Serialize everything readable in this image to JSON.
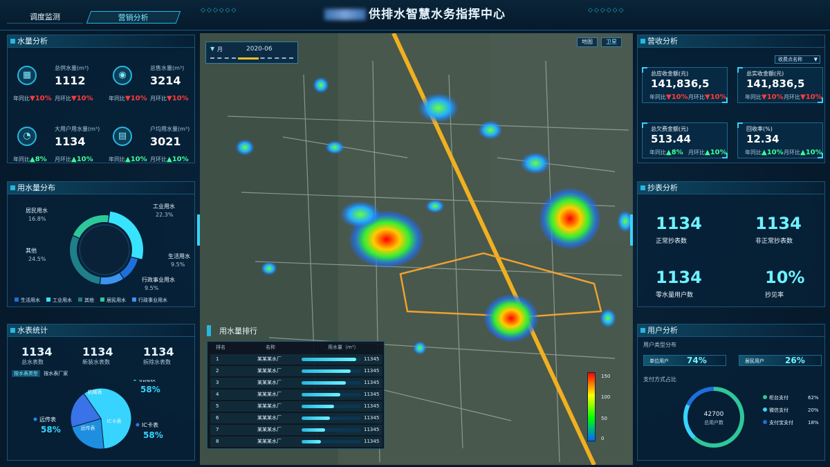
{
  "header": {
    "title": "供排水智慧水务指挥中心",
    "tab_monitor": "调度监测",
    "tab_sales": "营销分析"
  },
  "water_analysis": {
    "title": "水量分析",
    "items": [
      {
        "label": "总供水量(m³)",
        "value": "1112",
        "yoy_label": "年同比",
        "yoy": "10%",
        "mom_label": "月环比",
        "mom": "10%",
        "trend": "down"
      },
      {
        "label": "总售水量(m³)",
        "value": "3214",
        "yoy_label": "年同比",
        "yoy": "10%",
        "mom_label": "月环比",
        "mom": "10%",
        "trend": "down"
      },
      {
        "label": "大用户用水量(m³)",
        "value": "1134",
        "yoy_label": "年同比",
        "yoy": "8%",
        "mom_label": "月环比",
        "mom": "10%",
        "trend": "up"
      },
      {
        "label": "户均用水量(m³)",
        "value": "3021",
        "yoy_label": "年同比",
        "yoy": "10%",
        "mom_label": "月环比",
        "mom": "10%",
        "trend": "up"
      }
    ]
  },
  "distribution": {
    "title": "用水量分布",
    "slices": [
      {
        "name": "工业用水",
        "pct": "22.3%",
        "value": 22.3,
        "color": "#37e3ff"
      },
      {
        "name": "生活用水",
        "pct": "9.5%",
        "value": 9.5,
        "color": "#1e6fd9"
      },
      {
        "name": "行政事业用水",
        "pct": "9.5%",
        "value": 9.5,
        "color": "#3a94f0"
      },
      {
        "name": "其他",
        "pct": "24.5%",
        "value": 24.5,
        "color": "#1f7f8a"
      },
      {
        "name": "居民用水",
        "pct": "16.8%",
        "value": 16.8,
        "color": "#2ec79a"
      }
    ],
    "legend": [
      "生活用水",
      "工业用水",
      "其他",
      "居民用水",
      "行政事业用水"
    ],
    "legend_colors": [
      "#1e6fd9",
      "#37e3ff",
      "#1f7f8a",
      "#2ec79a",
      "#3a94f0"
    ]
  },
  "meter_stats": {
    "title": "水表统计",
    "items": [
      {
        "value": "1134",
        "label": "总水表数"
      },
      {
        "value": "1134",
        "label": "新装水表数"
      },
      {
        "value": "1134",
        "label": "拆除水表数"
      }
    ],
    "tabs": [
      "按水表类型",
      "按水表厂家"
    ],
    "pie": [
      {
        "name": "机械表",
        "pct": "58%",
        "value": 58,
        "color": "#37d4ff"
      },
      {
        "name": "远传表",
        "pct": "58%",
        "value": 22,
        "color": "#1e8fe0"
      },
      {
        "name": "IC卡表",
        "pct": "58%",
        "value": 20,
        "color": "#3a72e8"
      }
    ]
  },
  "map": {
    "month_label": "月",
    "month_value": "2020-06",
    "toggle_map": "地图",
    "toggle_satellite": "卫星",
    "legend_ticks": [
      "150",
      "100",
      "50",
      "0"
    ]
  },
  "ranking": {
    "title": "用水量排行",
    "col_rank": "排名",
    "col_name": "名称",
    "col_usage": "用水量（m³）",
    "rows": [
      {
        "rank": "1",
        "name": "某某某水厂",
        "value": "11345",
        "fill": 0.92
      },
      {
        "rank": "2",
        "name": "某某某水厂",
        "value": "11345",
        "fill": 0.82
      },
      {
        "rank": "3",
        "name": "某某某水厂",
        "value": "11345",
        "fill": 0.74
      },
      {
        "rank": "4",
        "name": "某某某水厂",
        "value": "11345",
        "fill": 0.65
      },
      {
        "rank": "5",
        "name": "某某某水厂",
        "value": "11345",
        "fill": 0.55
      },
      {
        "rank": "6",
        "name": "某某某水厂",
        "value": "11345",
        "fill": 0.48
      },
      {
        "rank": "7",
        "name": "某某某水厂",
        "value": "11345",
        "fill": 0.4
      },
      {
        "rank": "8",
        "name": "某某某水厂",
        "value": "11345",
        "fill": 0.32
      }
    ]
  },
  "revenue": {
    "title": "营收分析",
    "select": "收费点名称",
    "items": [
      {
        "label": "总应收金额(元)",
        "value": "141,836,5",
        "yoy_label": "年同比",
        "yoy": "10%",
        "mom_label": "月环比",
        "mom": "10%",
        "trend": "down"
      },
      {
        "label": "总实收金额(元)",
        "value": "141,836,5",
        "yoy_label": "年同比",
        "yoy": "10%",
        "mom_label": "月环比",
        "mom": "10%",
        "trend": "down"
      },
      {
        "label": "总欠费金额(元)",
        "value": "513.44",
        "yoy_label": "年同比",
        "yoy": "8%",
        "mom_label": "月环比",
        "mom": "10%",
        "trend": "up"
      },
      {
        "label": "回收率(%)",
        "value": "12.34",
        "yoy_label": "年同比",
        "yoy": "10%",
        "mom_label": "月环比",
        "mom": "10%",
        "trend": "up"
      }
    ]
  },
  "meter_reading": {
    "title": "抄表分析",
    "items": [
      {
        "value": "1134",
        "label": "正常抄表数"
      },
      {
        "value": "1134",
        "label": "非正常抄表数"
      },
      {
        "value": "1134",
        "label": "零水量用户数"
      },
      {
        "value": "10%",
        "label": "抄见率"
      }
    ]
  },
  "users": {
    "title": "用户分析",
    "type_title": "用户类型分布",
    "unit_label": "单位用户",
    "unit_pct": "74%",
    "unit_value": 74,
    "resident_label": "居民用户",
    "resident_pct": "26%",
    "resident_value": 26,
    "pay_title": "支付方式占比",
    "total": "42700",
    "total_label": "总用户数",
    "pay": [
      {
        "name": "柜台支付",
        "pct": "62%",
        "value": 62,
        "color": "#2ec79a"
      },
      {
        "name": "微信支付",
        "pct": "20%",
        "value": 20,
        "color": "#37d4ff"
      },
      {
        "name": "支付宝支付",
        "pct": "18%",
        "value": 18,
        "color": "#1e6fd9"
      }
    ]
  }
}
